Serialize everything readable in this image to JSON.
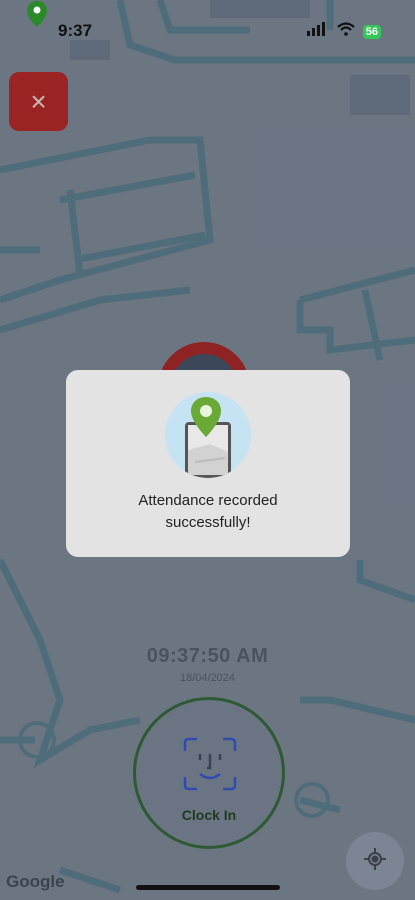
{
  "status_bar": {
    "time": "9:37",
    "battery": "56"
  },
  "close_button": {
    "label": "×"
  },
  "modal": {
    "message_line1": "Attendance recorded",
    "message_line2": "successfully!"
  },
  "clock": {
    "time": "09:37:50 AM",
    "date": "18/04/2024"
  },
  "clock_in": {
    "label": "Clock In"
  },
  "map": {
    "attribution": "Google"
  },
  "colors": {
    "dim_overlay": "#3c485a",
    "close_red": "#9a2424",
    "status_green": "#34c759",
    "clock_in_border": "#2d5a33"
  },
  "icons": [
    "location-pin-icon",
    "signal-icon",
    "wifi-icon",
    "battery-icon",
    "close-icon",
    "map-pin-icon",
    "face-id-icon",
    "locate-icon"
  ]
}
